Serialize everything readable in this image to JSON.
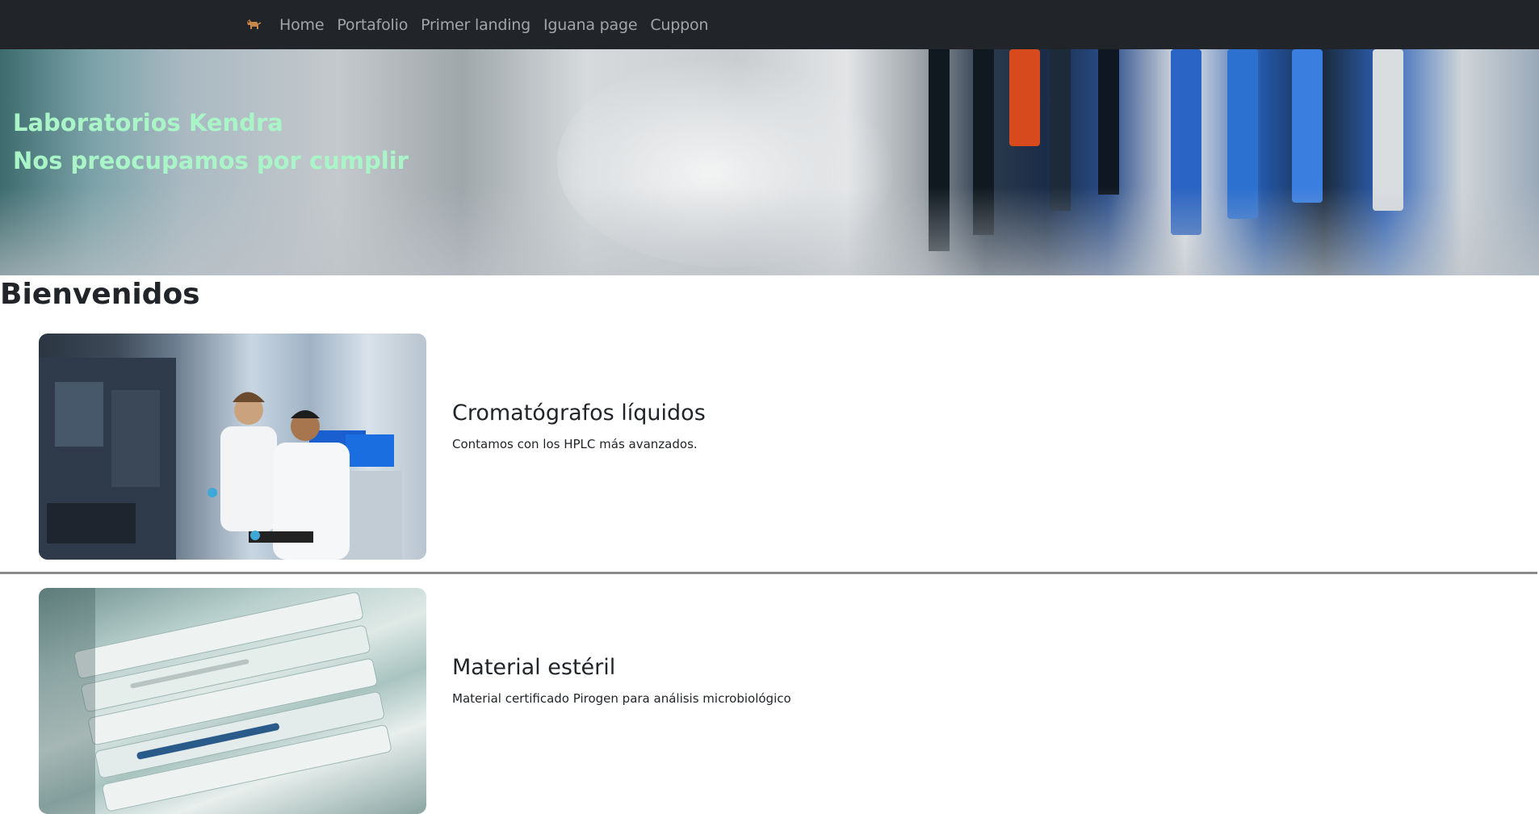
{
  "navbar": {
    "brand_icon": "dog-icon",
    "links": [
      "Home",
      "Portafolio",
      "Primer landing",
      "Iguana page",
      "Cuppon"
    ]
  },
  "hero": {
    "line1": "Laboratorios Kendra",
    "line2": "Nos preocupamos por cumplir",
    "text_color": "#a9f5c8"
  },
  "main": {
    "heading": "Bienvenidos",
    "features": [
      {
        "title": "Cromatógrafos líquidos",
        "description": "Contamos con los HPLC más avanzados.",
        "image": "lab-scientists-photo"
      },
      {
        "title": "Material estéril",
        "description": "Material certificado Pirogen para análisis microbiológico",
        "image": "sterile-material-photo"
      }
    ]
  },
  "colors": {
    "navbar_bg": "#212529",
    "nav_link": "#9b9da0"
  }
}
